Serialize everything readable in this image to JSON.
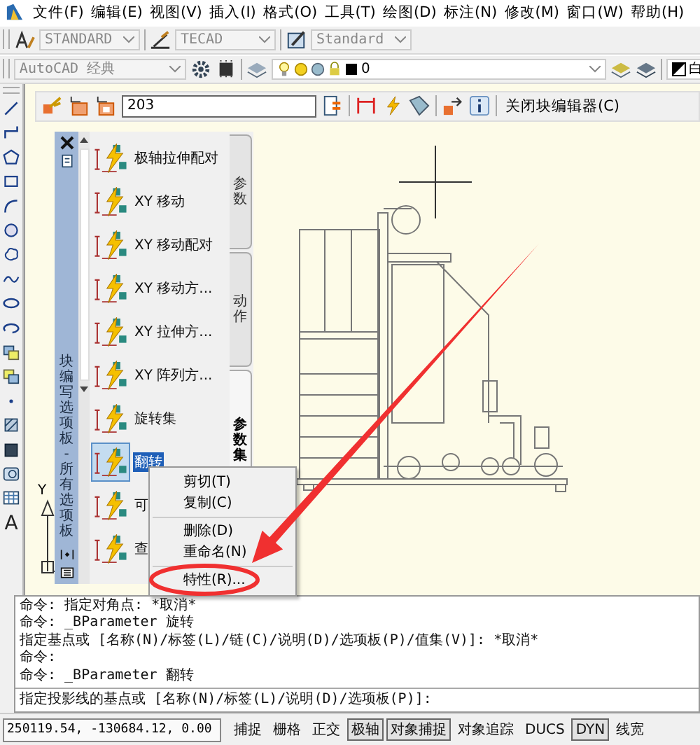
{
  "menu_bar": [
    "文件(F)",
    "编辑(E)",
    "视图(V)",
    "插入(I)",
    "格式(O)",
    "工具(T)",
    "绘图(D)",
    "标注(N)",
    "修改(M)",
    "窗口(W)",
    "帮助(H)"
  ],
  "style_toolbar": {
    "text_style": "STANDARD",
    "dim_style": "TECAD",
    "table_style": "Standard"
  },
  "workspace_toolbar": {
    "workspace": "AutoCAD 经典",
    "layer": "0",
    "color_name": "白"
  },
  "left_toolbar": {
    "text_icon": "A"
  },
  "block_editor_toolbar": {
    "block_name": "203",
    "close_button": "关闭块编辑器(C)"
  },
  "palette": {
    "title": "块编写选项板 - 所有选项板",
    "tabs": [
      {
        "label": "参数",
        "selected": false
      },
      {
        "label": "动作",
        "selected": false
      },
      {
        "label": "参数集",
        "selected": true
      }
    ],
    "items": [
      {
        "label": "极轴拉伸配对",
        "selected": false
      },
      {
        "label": "XY 移动",
        "selected": false
      },
      {
        "label": "XY 移动配对",
        "selected": false
      },
      {
        "label": "XY 移动方...",
        "selected": false
      },
      {
        "label": "XY 拉伸方...",
        "selected": false
      },
      {
        "label": "XY 阵列方...",
        "selected": false
      },
      {
        "label": "旋转集",
        "selected": false
      },
      {
        "label": "翻转",
        "selected": true
      },
      {
        "label": "可",
        "selected": false
      },
      {
        "label": "查",
        "selected": false
      }
    ]
  },
  "ucs_icon": {
    "axis_label": "Y"
  },
  "context_menu": {
    "items": [
      {
        "kind": "item",
        "label": "剪切(T)"
      },
      {
        "kind": "item",
        "label": "复制(C)"
      },
      {
        "kind": "separator"
      },
      {
        "kind": "item",
        "label": "删除(D)"
      },
      {
        "kind": "item",
        "label": "重命名(N)"
      },
      {
        "kind": "separator"
      },
      {
        "kind": "item",
        "label": "特性(R)..."
      }
    ]
  },
  "command_history": [
    "命令: 指定对角点: *取消*",
    "命令: _BParameter 旋转",
    "指定基点或 [名称(N)/标签(L)/链(C)/说明(D)/选项板(P)/值集(V)]: *取消*",
    "命令:",
    "命令: _BParameter 翻转"
  ],
  "command_prompt": "指定投影线的基点或 [名称(N)/标签(L)/说明(D)/选项板(P)]:",
  "status_bar": {
    "coordinates": "250119.54, -130684.12, 0.00",
    "toggles": [
      {
        "label": "捕捉",
        "on": false
      },
      {
        "label": "栅格",
        "on": false
      },
      {
        "label": "正交",
        "on": false
      },
      {
        "label": "极轴",
        "on": true
      },
      {
        "label": "对象捕捉",
        "on": true
      },
      {
        "label": "对象追踪",
        "on": false
      },
      {
        "label": "DUCS",
        "on": false
      },
      {
        "label": "DYN",
        "on": true
      },
      {
        "label": "线宽",
        "on": false
      }
    ]
  }
}
